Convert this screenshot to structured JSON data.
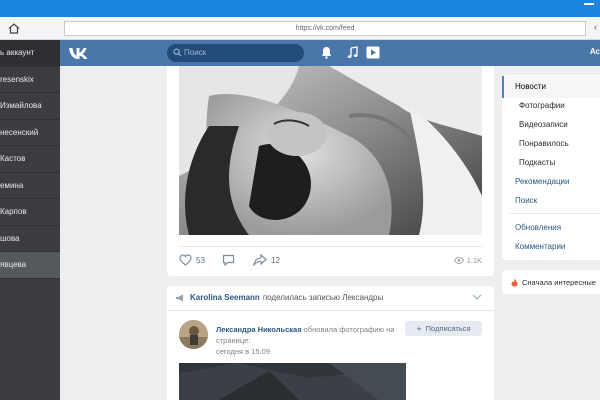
{
  "browser": {
    "url": "https://vk.com/feed"
  },
  "accounts": [
    "ь аккаунт",
    "resenskix",
    "Измайлова",
    "несенский",
    "Кастов",
    "емина",
    "Карпов",
    "шова",
    "явцева"
  ],
  "header": {
    "search_placeholder": "Поиск",
    "right_label": "Ас"
  },
  "post": {
    "likes": "53",
    "shares": "12",
    "views": "1.1K"
  },
  "share": {
    "author": "Karolina Seemann",
    "action": "поделилась записью Лександры",
    "poster": "Лександра Никольская",
    "poster_action": "обновила фотографию на странице:",
    "time": "сегодня в 15:09",
    "subscribe_label": "Подписаться"
  },
  "news_menu": {
    "active": "Новости",
    "photos": "Фотографии",
    "videos": "Видеозаписи",
    "liked": "Понравилось",
    "podcasts": "Подкасты",
    "recommendations": "Рекомендации",
    "search": "Поиск",
    "updates": "Обновления",
    "comments": "Комментарии"
  },
  "interesting": {
    "label": "Сначала интересные"
  },
  "colors": {
    "vk_blue": "#4a76a8",
    "link_blue": "#2a5885",
    "window_blue": "#1a86e0",
    "panel_dark": "#3b3d41"
  }
}
